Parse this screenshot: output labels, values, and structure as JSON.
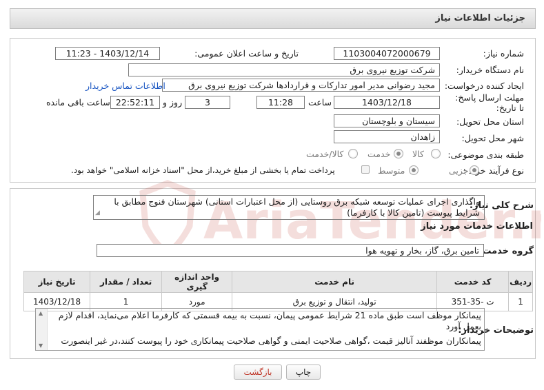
{
  "header": {
    "title": "جزئیات اطلاعات نیاز"
  },
  "form": {
    "need_number": {
      "label": "شماره نیاز:",
      "value": "1103004072000679"
    },
    "announce_datetime": {
      "label": "تاریخ و ساعت اعلان عمومی:",
      "value": "1403/12/14 - 11:23"
    },
    "buyer_org": {
      "label": "نام دستگاه خریدار:",
      "value": "شرکت توزیع نیروی برق"
    },
    "requester": {
      "label": "ایجاد کننده درخواست:",
      "value": "مجید  رضوانی مدیر امور تدارکات و قراردادها شرکت توزیع نیروی برق",
      "contact_link": "اطلاعات تماس خریدار"
    },
    "deadline": {
      "label": "مهلت ارسال پاسخ: تا تاریخ:",
      "date": "1403/12/18",
      "time_label": "ساعت",
      "time": "11:28",
      "days": "3",
      "days_label": "روز و",
      "remaining": "22:52:11",
      "remaining_label": "ساعت باقی مانده"
    },
    "province": {
      "label": "استان محل تحویل:",
      "value": "سیستان و بلوچستان"
    },
    "city": {
      "label": "شهر محل تحویل:",
      "value": "زاهدان"
    },
    "category": {
      "label": "طبقه بندی موضوعی:",
      "options": [
        "کالا",
        "خدمت",
        "کالا/خدمت"
      ],
      "selected": "خدمت"
    },
    "process": {
      "label": "نوع فرآیند خرید :",
      "options": [
        "جزیی",
        "متوسط"
      ],
      "selected": "جزیی",
      "payment_note": "پرداخت تمام یا بخشی از مبلغ خرید،از محل \"اسناد خزانه اسلامی\" خواهد بود."
    }
  },
  "description": {
    "label": "شرح کلی نیاز:",
    "text": "واگذاری اجرای عملیات توسعه شبکه برق روستایی (از محل اعتبارات استانی) شهرستان فنوج مطابق با شرایط پیوست (تامین کالا با کارفرما)"
  },
  "services": {
    "title": "اطلاعات خدمات مورد نیاز",
    "group_label": "گروه خدمت:",
    "group_value": "تامین برق، گاز، بخار و تهویه هوا",
    "columns": [
      "ردیف",
      "کد خدمت",
      "نام خدمت",
      "واحد اندازه گیری",
      "تعداد / مقدار",
      "تاریخ نیاز"
    ],
    "rows": [
      [
        "1",
        "ت -35-351",
        "تولید، انتقال و توزیع برق",
        "مورد",
        "1",
        "1403/12/18"
      ]
    ]
  },
  "buyer_notes": {
    "label": "توضیحات خریدار:",
    "lines": [
      "پیمانکار موظف است طبق ماده 21 شرایط عمومی پیمان، نسبت به بیمه قسمتی که کارفرما اعلام می‌نماید، اقدام لازم بعمل آورد",
      "پیمانکاران موظفند آنالیز قیمت ،گواهی صلاحیت ایمنی و گواهی صلاحیت پیمانکاری خود را پیوست کنند،در غیر اینصورت"
    ]
  },
  "buttons": {
    "print": "چاپ",
    "back": "بازگشت"
  },
  "watermark": {
    "text": "AriaTender.net"
  },
  "colors": {
    "link": "#1a56c2",
    "back_button_text": "#c0392b",
    "watermark": "#c0392b"
  }
}
